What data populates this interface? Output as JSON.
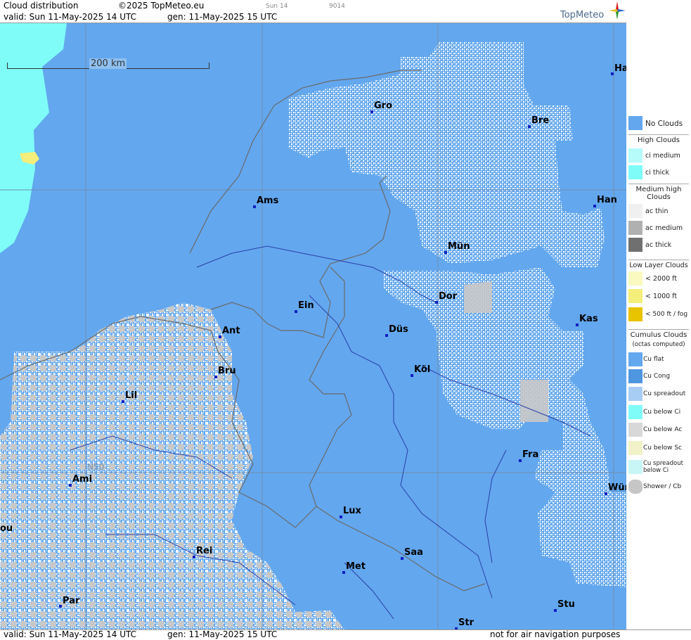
{
  "header": {
    "title": "Cloud distribution",
    "copyright": "©2025 TopMeteo.eu",
    "run_tag": "Sun 14",
    "code": "9014",
    "valid": "valid:  Sun  11-May-2025  14 UTC",
    "generated": "gen: 11-May-2025 15 UTC",
    "logo": "TopMeteo"
  },
  "map": {
    "scale_label": "200 km",
    "lat_label": "N50",
    "cities": [
      {
        "name": "Gro"
      },
      {
        "name": "Bre"
      },
      {
        "name": "Ha"
      },
      {
        "name": "Ams"
      },
      {
        "name": "Han"
      },
      {
        "name": "Mün"
      },
      {
        "name": "Dor"
      },
      {
        "name": "Ein"
      },
      {
        "name": "Ant"
      },
      {
        "name": "Düs"
      },
      {
        "name": "Kas"
      },
      {
        "name": "Bru"
      },
      {
        "name": "Köl"
      },
      {
        "name": "Lil"
      },
      {
        "name": "Fra"
      },
      {
        "name": "Ami"
      },
      {
        "name": "Wür"
      },
      {
        "name": "Lux"
      },
      {
        "name": "ou"
      },
      {
        "name": "Rei"
      },
      {
        "name": "Saa"
      },
      {
        "name": "Met"
      },
      {
        "name": "Par"
      },
      {
        "name": "Stu"
      },
      {
        "name": "Str"
      }
    ]
  },
  "legend": {
    "no_clouds": "No Clouds",
    "high_head": "High Clouds",
    "ci_medium": "ci medium",
    "ci_thick": "ci thick",
    "medium_head": "Medium high Clouds",
    "ac_thin": "ac thin",
    "ac_medium": "ac medium",
    "ac_thick": "ac thick",
    "low_head": "Low Layer Clouds",
    "low_2000": "< 2000 ft",
    "low_1000": "< 1000 ft",
    "low_500": "< 500 ft / fog",
    "cu_head": "Cumulus Clouds",
    "cu_sub": "(octas computed)",
    "cu_flat": "Cu flat",
    "cu_cong": "Cu Cong",
    "cu_spreadout": "Cu spreadout",
    "cu_below_ci": "Cu below Ci",
    "cu_below_ac": "Cu below Ac",
    "cu_below_sc": "Cu below Sc",
    "cu_spreadout_below_ci": "Cu spreadout below Ci",
    "shower": "Shower / Cb"
  },
  "footer": {
    "valid": "valid:  Sun  11-May-2025  14 UTC",
    "generated": "gen: 11-May-2025 15 UTC",
    "disclaimer": "not for air navigation purposes"
  },
  "colors": {
    "no_clouds": "#63a7ee",
    "ci_thick": "#7ffcf8",
    "low_cloud": "#f4ee7a",
    "cu": "#ffffff",
    "shower": "#c6c6c6"
  }
}
